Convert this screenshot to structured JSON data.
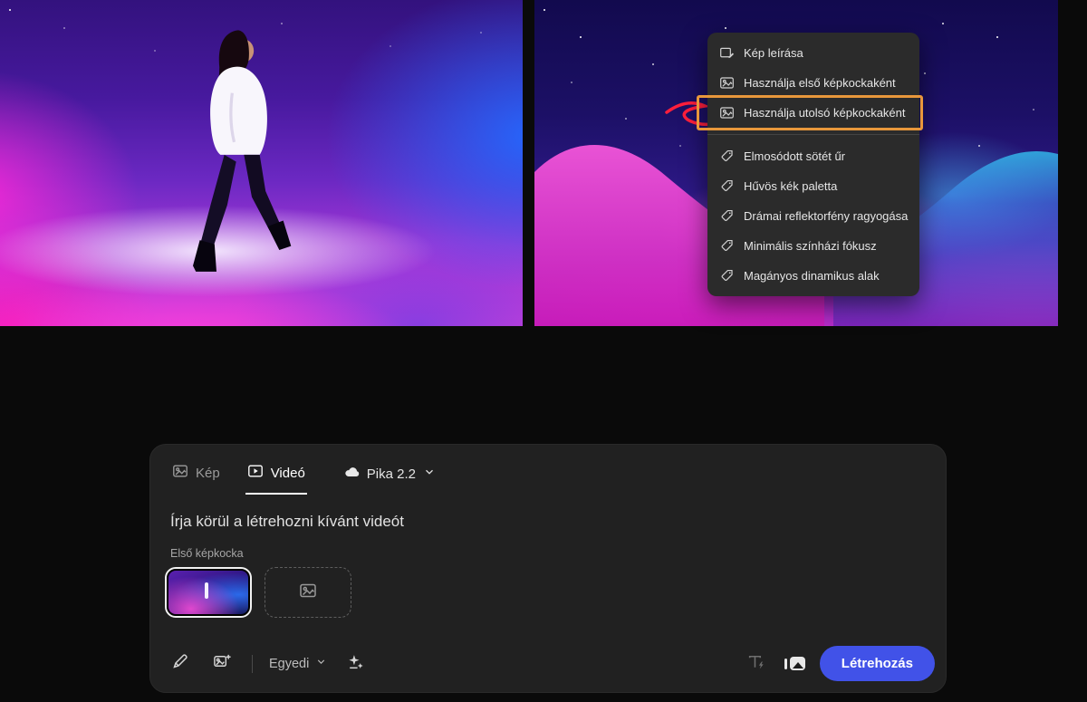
{
  "context_menu": {
    "actions": [
      {
        "label": "Kép leírása"
      },
      {
        "label": "Használja első képkockaként"
      },
      {
        "label": "Használja utolsó képkockaként"
      }
    ],
    "tags": [
      {
        "label": "Elmosódott sötét űr"
      },
      {
        "label": "Hűvös kék paletta"
      },
      {
        "label": "Drámai reflektorfény ragyogása"
      },
      {
        "label": "Minimális színházi fókusz"
      },
      {
        "label": "Magányos dinamikus alak"
      }
    ]
  },
  "composer": {
    "tab_image": "Kép",
    "tab_video": "Videó",
    "model": "Pika 2.2",
    "prompt_placeholder": "Írja körül a létrehozni kívánt videót",
    "first_frame_label": "Első képkocka",
    "custom_label": "Egyedi",
    "generate_label": "Létrehozás"
  },
  "icons": {
    "menu": [
      "describe-image-icon",
      "image-frame-icon",
      "tag-icon"
    ],
    "composer": [
      "photo-icon",
      "video-play-icon",
      "cloud-icon",
      "chevron-down-icon",
      "pen-icon",
      "image-add-icon",
      "effects-icon",
      "text-generate-icon",
      "image-to-video-icon"
    ]
  },
  "colors": {
    "highlight_orange": "#E8973B",
    "accent_blue": "#4152E8",
    "menu_bg": "#2B2B2B",
    "panel_bg": "#212121",
    "page_bg": "#0A0A0A"
  }
}
